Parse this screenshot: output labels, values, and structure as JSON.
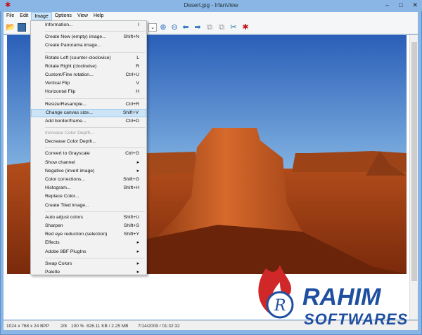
{
  "window": {
    "title": "Desert.jpg - IrfanView"
  },
  "menubar": [
    "File",
    "Edit",
    "Image",
    "Options",
    "View",
    "Help"
  ],
  "image_menu": [
    {
      "label": "Information...",
      "shortcut": "I"
    },
    {
      "sep": true
    },
    {
      "label": "Create New (empty) image...",
      "shortcut": "Shift+N"
    },
    {
      "label": "Create Panorama image...",
      "shortcut": ""
    },
    {
      "sep": true
    },
    {
      "label": "Rotate Left (counter-clockwise)",
      "shortcut": "L"
    },
    {
      "label": "Rotate Right (clockwise)",
      "shortcut": "R"
    },
    {
      "label": "Custom/Fine rotation...",
      "shortcut": "Ctrl+U"
    },
    {
      "label": "Vertical Flip",
      "shortcut": "V"
    },
    {
      "label": "Horizontal Flip",
      "shortcut": "H"
    },
    {
      "sep": true
    },
    {
      "label": "Resize/Resample...",
      "shortcut": "Ctrl+R"
    },
    {
      "label": "Change canvas size...",
      "shortcut": "Shift+V",
      "highlighted": true
    },
    {
      "label": "Add border/frame...",
      "shortcut": "Ctrl+D"
    },
    {
      "sep": true
    },
    {
      "label": "Increase Color Depth...",
      "shortcut": "",
      "disabled": true
    },
    {
      "label": "Decrease Color Depth...",
      "shortcut": ""
    },
    {
      "sep": true
    },
    {
      "label": "Convert to Grayscale",
      "shortcut": "Ctrl+G"
    },
    {
      "label": "Show channel",
      "shortcut": "▸"
    },
    {
      "label": "Negative (invert image)",
      "shortcut": "▸"
    },
    {
      "label": "Color corrections...",
      "shortcut": "Shift+G"
    },
    {
      "label": "Histogram...",
      "shortcut": "Shift+H"
    },
    {
      "label": "Replace Color...",
      "shortcut": ""
    },
    {
      "label": "Create Tiled image...",
      "shortcut": ""
    },
    {
      "sep": true
    },
    {
      "label": "Auto adjust colors",
      "shortcut": "Shift+U"
    },
    {
      "label": "Sharpen",
      "shortcut": "Shift+S"
    },
    {
      "label": "Red eye reduction (selection)",
      "shortcut": "Shift+Y"
    },
    {
      "label": "Effects",
      "shortcut": "▸"
    },
    {
      "label": "Adobe 8BF PlugIns",
      "shortcut": "▸"
    },
    {
      "sep": true
    },
    {
      "label": "Swap Colors",
      "shortcut": "▸"
    },
    {
      "label": "Palette",
      "shortcut": "▸"
    }
  ],
  "status": {
    "dimensions": "1024 x 768 x 24 BPP",
    "index": "2/8",
    "zoom": "100 %",
    "size": "826.11 KB / 2.25 MB",
    "date": "7/14/2009 / 01:32:32"
  },
  "watermark": {
    "line1": "RAHIM",
    "line2": "SOFTWARES"
  }
}
